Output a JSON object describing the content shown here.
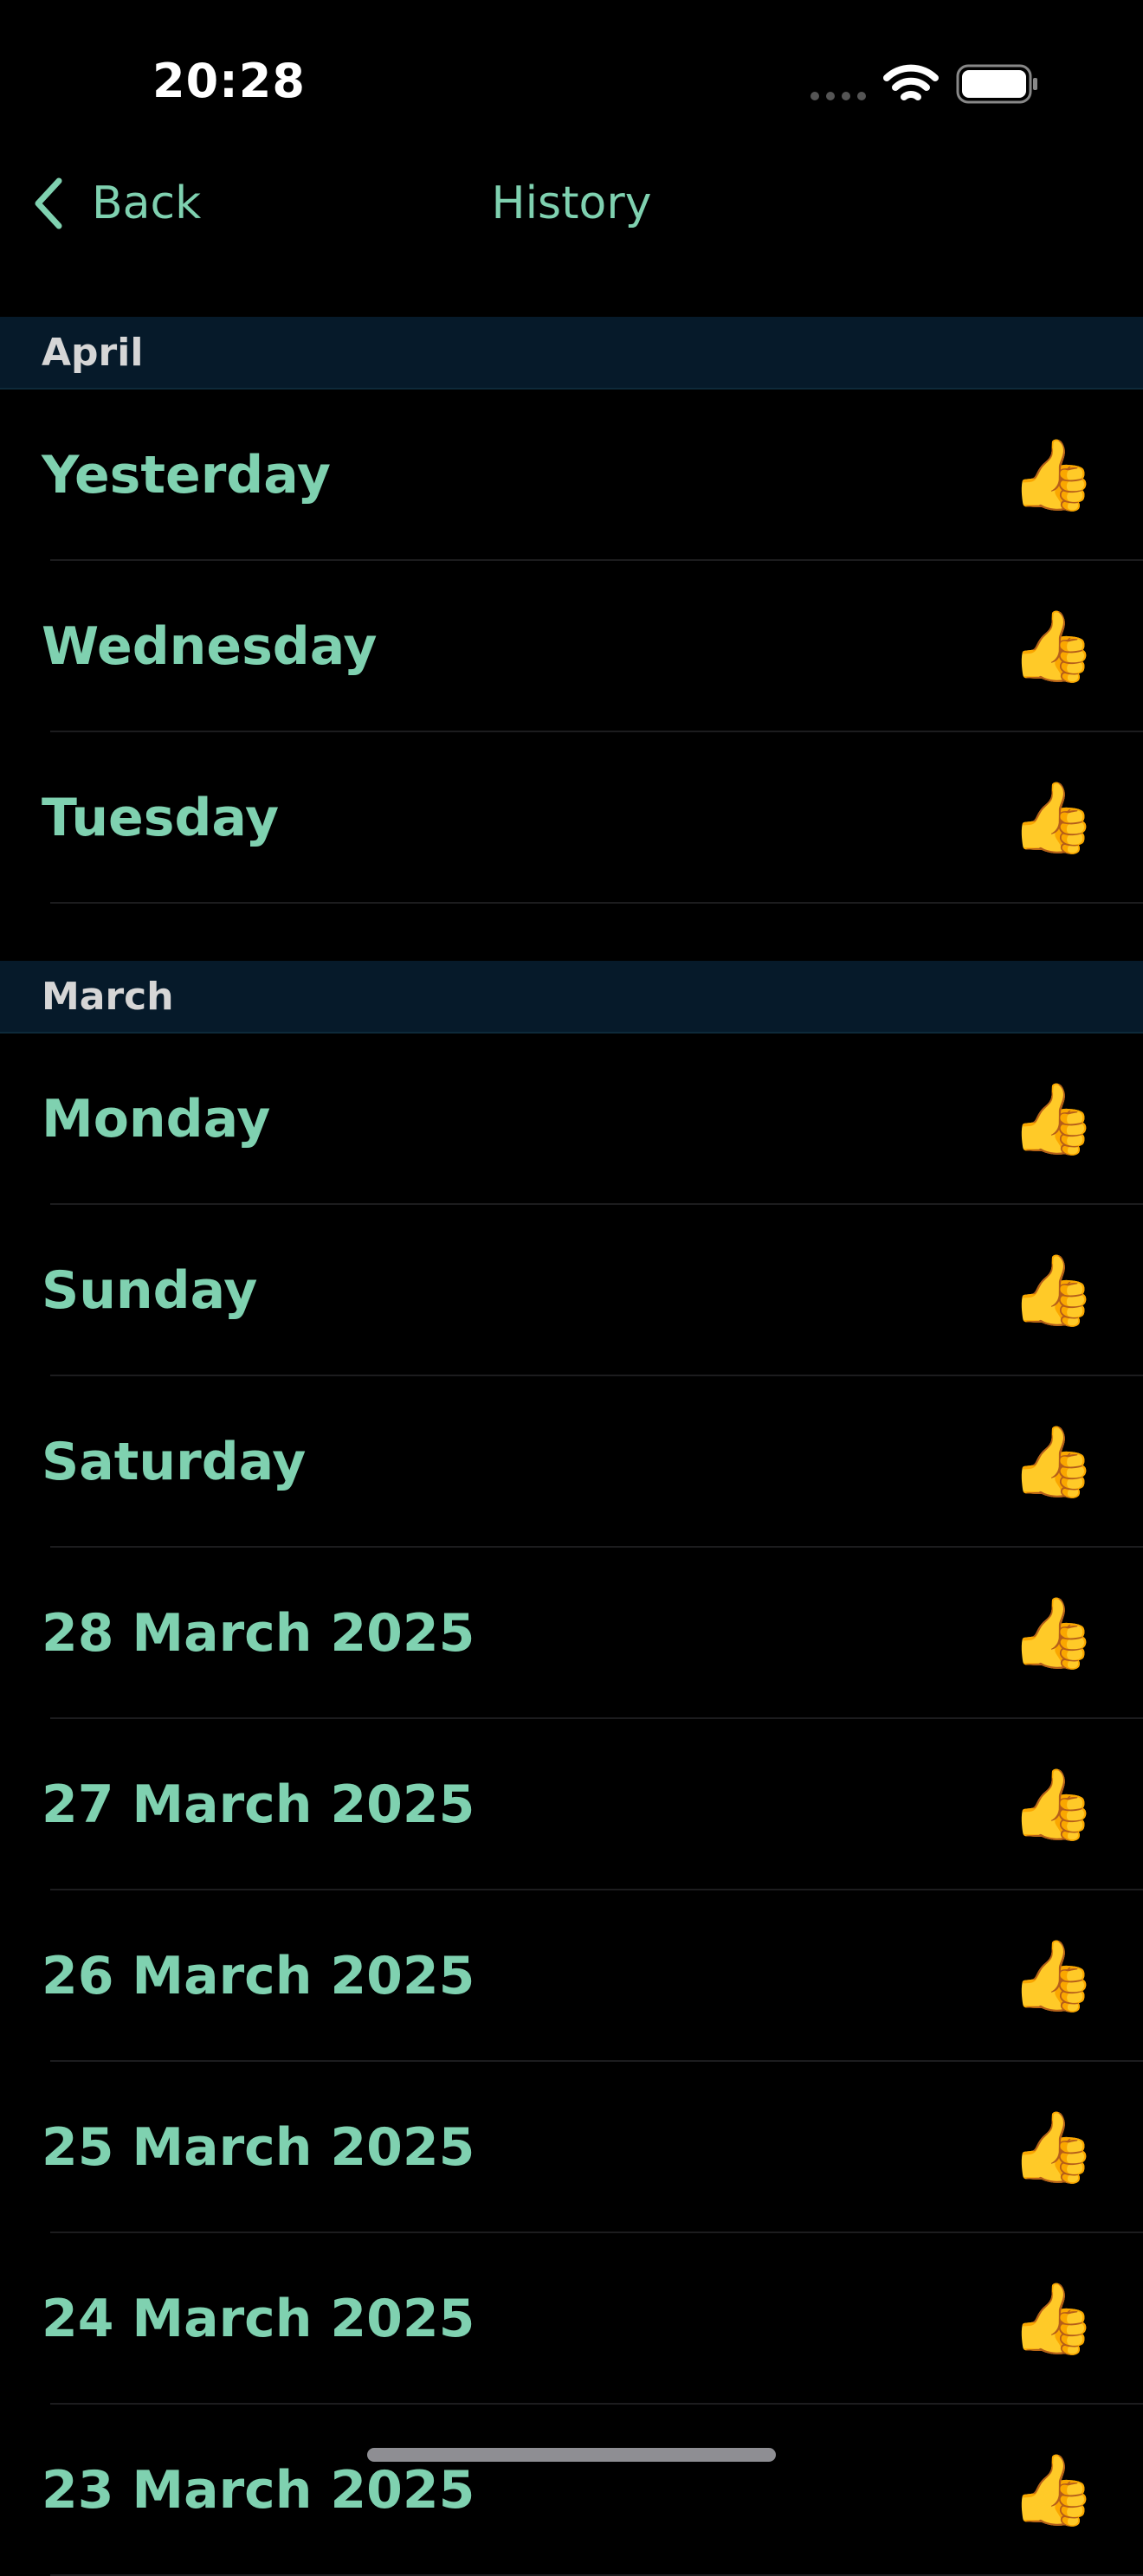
{
  "status_bar": {
    "time": "20:28",
    "icons": [
      "signal-dots-icon",
      "wifi-icon",
      "battery-icon"
    ]
  },
  "nav": {
    "back_label": "Back",
    "back_icon": "chevron-left-icon",
    "title": "History"
  },
  "colors": {
    "background": "#000000",
    "accent": "#7fd1b0",
    "section_background": "#061a2a",
    "section_text": "#d6d6d6",
    "divider": "#1c1c1e"
  },
  "sections": [
    {
      "title": "April",
      "rows": [
        {
          "label": "Yesterday",
          "rating": "👍",
          "rating_icon": "thumbs-up-icon"
        },
        {
          "label": "Wednesday",
          "rating": "👍",
          "rating_icon": "thumbs-up-icon"
        },
        {
          "label": "Tuesday",
          "rating": "👍",
          "rating_icon": "thumbs-up-icon"
        }
      ]
    },
    {
      "title": "March",
      "rows": [
        {
          "label": "Monday",
          "rating": "👍",
          "rating_icon": "thumbs-up-icon"
        },
        {
          "label": "Sunday",
          "rating": "👍",
          "rating_icon": "thumbs-up-icon"
        },
        {
          "label": "Saturday",
          "rating": "👍",
          "rating_icon": "thumbs-up-icon"
        },
        {
          "label": "28 March 2025",
          "rating": "👍",
          "rating_icon": "thumbs-up-icon"
        },
        {
          "label": "27 March 2025",
          "rating": "👍",
          "rating_icon": "thumbs-up-icon"
        },
        {
          "label": "26 March 2025",
          "rating": "👍",
          "rating_icon": "thumbs-up-icon"
        },
        {
          "label": "25 March 2025",
          "rating": "👍",
          "rating_icon": "thumbs-up-icon"
        },
        {
          "label": "24 March 2025",
          "rating": "👍",
          "rating_icon": "thumbs-up-icon"
        },
        {
          "label": "23 March 2025",
          "rating": "👍",
          "rating_icon": "thumbs-up-icon"
        }
      ]
    }
  ]
}
